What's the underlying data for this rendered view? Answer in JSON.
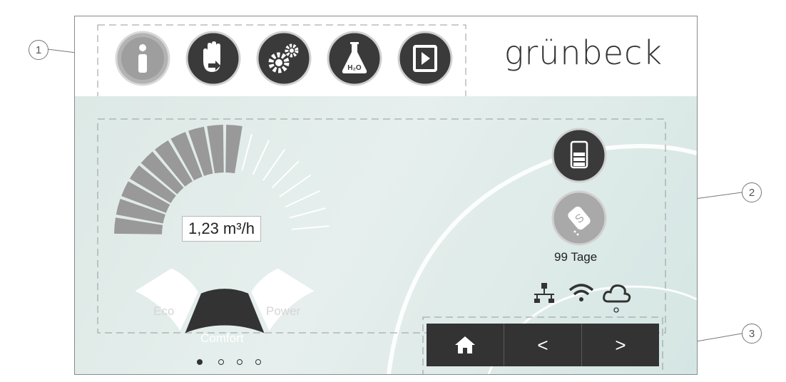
{
  "brand": {
    "name": "grünbeck"
  },
  "toolbar": {
    "items": [
      {
        "name": "info-icon",
        "state": "inactive"
      },
      {
        "name": "manual-hand-icon"
      },
      {
        "name": "settings-gears-icon"
      },
      {
        "name": "water-test-flask-icon",
        "label": "H₂O"
      },
      {
        "name": "logout-icon"
      }
    ]
  },
  "gauge": {
    "flow_value": "1,23 m³/h",
    "filled_segments": 10,
    "total_segments": 18,
    "modes": [
      "Eco",
      "Comfort",
      "Power"
    ],
    "active_mode": "Comfort"
  },
  "status": {
    "salt_days": "99 Tage",
    "icons": [
      "storage-battery-icon",
      "salt-icon",
      "network-icon",
      "wifi-icon",
      "cloud-icon"
    ]
  },
  "pager": {
    "pages": 4,
    "current": 1
  },
  "nav": {
    "home_label": "⌂",
    "prev_label": "<",
    "next_label": ">"
  },
  "callouts": [
    "1",
    "2",
    "3"
  ],
  "colors": {
    "dark": "#333333",
    "gauge_filled": "#999999",
    "gauge_empty": "#ffffff",
    "background": "#dde9e6"
  }
}
